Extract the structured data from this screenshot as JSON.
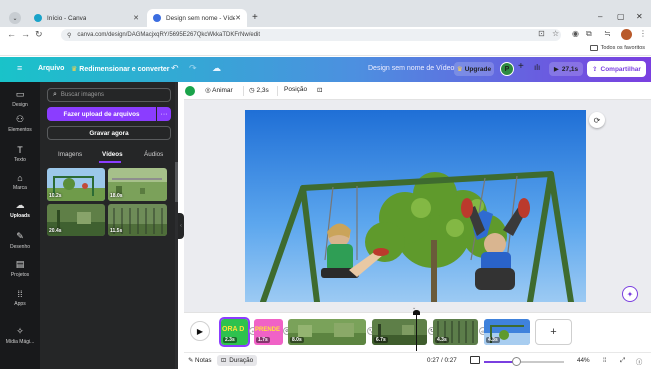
{
  "browser": {
    "tabs": [
      {
        "title": "Início - Canva",
        "active": false,
        "favicon_color": "#19a3c9"
      },
      {
        "title": "Design sem nome - Vídeo",
        "active": true,
        "favicon_color": "#3b6de0"
      }
    ],
    "new_tab_label": "+",
    "url": "canva.com/design/DAGMacjxqRY/5695E267QkcWkkaTDKFrNw/edit",
    "bookmarks_label": "Todos os favoritos",
    "window_controls": {
      "minimize": "–",
      "maximize": "▢",
      "close": "✕"
    }
  },
  "header": {
    "menu_icon": "≡",
    "file_label": "Arquivo",
    "resize_label": "Redimensionar e converter",
    "design_title": "Design sem nome de Vídeo",
    "upgrade_label": "Upgrade",
    "avatar_initial": "P",
    "plus_label": "+",
    "play_time": "27,1s",
    "share_label": "Compartilhar",
    "gradient_start": "#19c3c9",
    "gradient_end": "#7a3fe0"
  },
  "rail": {
    "items": [
      {
        "label": "Design",
        "icon": "▭",
        "active": false
      },
      {
        "label": "Elementos",
        "icon": "⚇",
        "active": false
      },
      {
        "label": "Texto",
        "icon": "T",
        "active": false
      },
      {
        "label": "Marca",
        "icon": "⌂",
        "active": false
      },
      {
        "label": "Uploads",
        "icon": "☁",
        "active": true
      },
      {
        "label": "Desenho",
        "icon": "✎",
        "active": false
      },
      {
        "label": "Projetos",
        "icon": "▤",
        "active": false
      },
      {
        "label": "Apps",
        "icon": "⁞⁞",
        "active": false
      },
      {
        "label": "Mídia Mági...",
        "icon": "✧",
        "active": false
      }
    ]
  },
  "panel": {
    "search_placeholder": "Buscar imagens",
    "upload_label": "Fazer upload de arquivos",
    "more_label": "···",
    "record_label": "Gravar agora",
    "tabs": [
      {
        "label": "Imagens",
        "active": false
      },
      {
        "label": "Vídeos",
        "active": true
      },
      {
        "label": "Áudios",
        "active": false
      }
    ],
    "videos": [
      {
        "duration": "10.2s"
      },
      {
        "duration": "18.0s"
      },
      {
        "duration": "20.4s"
      },
      {
        "duration": "11.5s"
      }
    ],
    "accent": "#8b3dff"
  },
  "context_bar": {
    "animate_label": "Animar",
    "duration_label": "2,3s",
    "position_label": "Posição"
  },
  "timeline": {
    "clips": [
      {
        "label": "2.3s",
        "text": "ORA D",
        "selected": true
      },
      {
        "label": "1.7s",
        "text": "PRENDE",
        "selected": false
      },
      {
        "label": "8.0s",
        "text": "",
        "selected": false
      },
      {
        "label": "6.7s",
        "text": "",
        "selected": false
      },
      {
        "label": "4.3s",
        "text": "",
        "selected": false
      },
      {
        "label": "4.3s",
        "text": "",
        "selected": false
      }
    ],
    "add_label": "+"
  },
  "statusbar": {
    "notes_label": "Notas",
    "duration_label": "Duração",
    "time_readout": "0:27 / 0:27",
    "zoom_level": "44%",
    "zoom_fraction": 0.44
  }
}
